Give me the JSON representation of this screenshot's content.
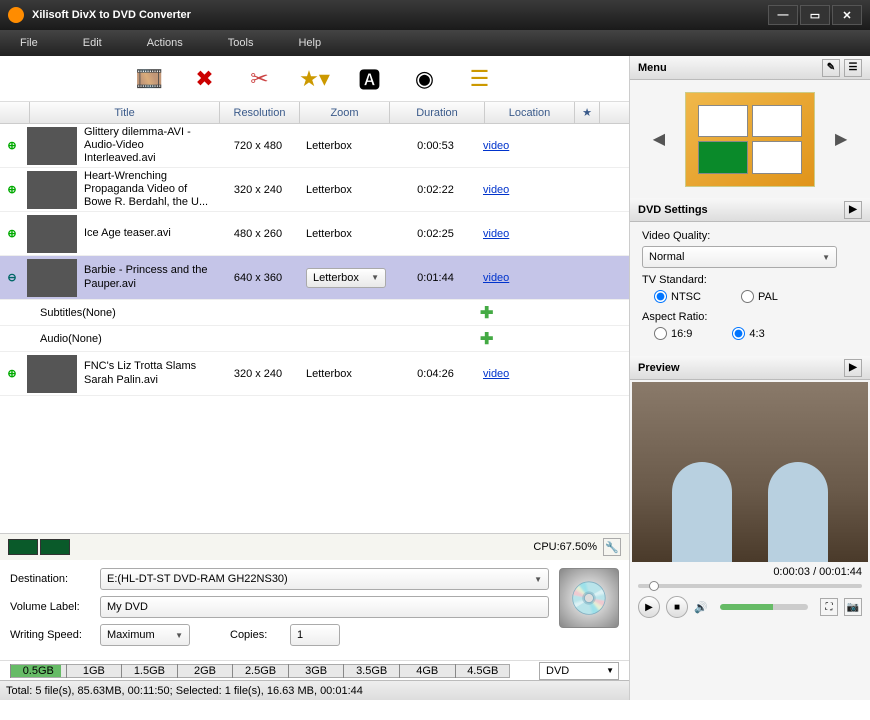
{
  "window": {
    "title": "Xilisoft DivX to DVD Converter"
  },
  "menu": {
    "file": "File",
    "edit": "Edit",
    "actions": "Actions",
    "tools": "Tools",
    "help": "Help"
  },
  "table": {
    "headers": {
      "title": "Title",
      "resolution": "Resolution",
      "zoom": "Zoom",
      "duration": "Duration",
      "location": "Location",
      "star": "★"
    },
    "rows": [
      {
        "title": "Glittery dilemma-AVI - Audio-Video Interleaved.avi",
        "res": "720 x 480",
        "zoom": "Letterbox",
        "dur": "0:00:53",
        "loc": "video",
        "selected": false,
        "thumb": "t0"
      },
      {
        "title": "Heart-Wrenching Propaganda Video of Bowe R. Berdahl, the U...",
        "res": "320 x 240",
        "zoom": "Letterbox",
        "dur": "0:02:22",
        "loc": "video",
        "selected": false,
        "thumb": "t1"
      },
      {
        "title": "Ice Age teaser.avi",
        "res": "480 x 260",
        "zoom": "Letterbox",
        "dur": "0:02:25",
        "loc": "video",
        "selected": false,
        "thumb": "t2"
      },
      {
        "title": "Barbie - Princess and the Pauper.avi",
        "res": "640 x 360",
        "zoom": "Letterbox",
        "dur": "0:01:44",
        "loc": "video",
        "selected": true,
        "thumb": "t3"
      },
      {
        "title": "FNC's Liz Trotta Slams Sarah Palin.avi",
        "res": "320 x 240",
        "zoom": "Letterbox",
        "dur": "0:04:26",
        "loc": "video",
        "selected": false,
        "thumb": "t4"
      }
    ],
    "subtitles": "Subtitles(None)",
    "audio": "Audio(None)"
  },
  "cpu": {
    "label": "CPU:67.50%"
  },
  "dest": {
    "label": "Destination:",
    "value": "E:(HL-DT-ST DVD-RAM GH22NS30)",
    "volume_label_label": "Volume Label:",
    "volume_label": "My DVD",
    "speed_label": "Writing Speed:",
    "speed": "Maximum",
    "copies_label": "Copies:",
    "copies": "1"
  },
  "storage": {
    "ticks": [
      "0.5GB",
      "1GB",
      "1.5GB",
      "2GB",
      "2.5GB",
      "3GB",
      "3.5GB",
      "4GB",
      "4.5GB"
    ],
    "media": "DVD"
  },
  "status": "Total: 5 file(s), 85.63MB, 00:11:50; Selected: 1 file(s), 16.63 MB, 00:01:44",
  "right": {
    "menu_label": "Menu",
    "dvd_settings_label": "DVD Settings",
    "video_quality_label": "Video Quality:",
    "video_quality": "Normal",
    "tv_label": "TV Standard:",
    "ntsc": "NTSC",
    "pal": "PAL",
    "aspect_label": "Aspect Ratio:",
    "ar169": "16:9",
    "ar43": "4:3",
    "preview_label": "Preview",
    "time": "0:00:03 / 00:01:44"
  }
}
